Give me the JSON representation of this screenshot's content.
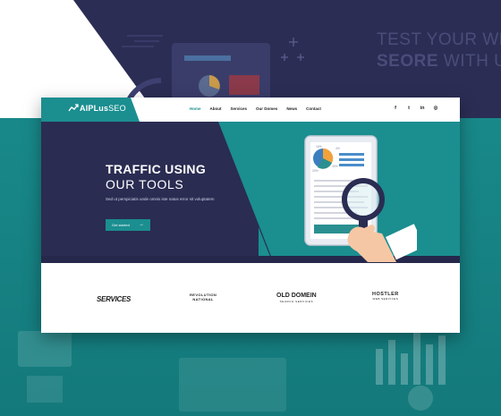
{
  "background": {
    "headline_line1": "TEST YOUR WE",
    "headline_line2_bold": "SEORE",
    "headline_line2_rest": " WITH U"
  },
  "nav": {
    "logo_bold": "AIPLus",
    "logo_thin": "SEO",
    "menu": [
      "Home",
      "About",
      "Services",
      "Our Domes",
      "News",
      "Contact"
    ],
    "active_index": 0,
    "social": [
      {
        "icon": "facebook-icon",
        "glyph": "f"
      },
      {
        "icon": "twitter-icon",
        "glyph": "t"
      },
      {
        "icon": "linkedin-icon",
        "glyph": "in"
      },
      {
        "icon": "instagram-icon",
        "glyph": "◎"
      }
    ]
  },
  "hero": {
    "title_line1": "TRAFFIC USING",
    "title_line2": "OUR TOOLS",
    "subtitle": "Sed ut perspiciatis unde omnis iste natus error sit voluptatem",
    "button_label": "Get started",
    "illustration_stats": [
      "4%",
      "20%",
      "40%",
      "16%"
    ]
  },
  "partners": {
    "p1": "SERVICES",
    "p2_line1": "REVOLUTION",
    "p2_line2": "NATIONAL",
    "p3": "OLD DOMEIN",
    "p3_sub": "SEARCH SERVICES",
    "p4": "HOSTLER",
    "p4_sub": "WEB SERVICES"
  },
  "colors": {
    "teal": "#1b8e90",
    "navy": "#2a2c52",
    "white": "#ffffff"
  }
}
